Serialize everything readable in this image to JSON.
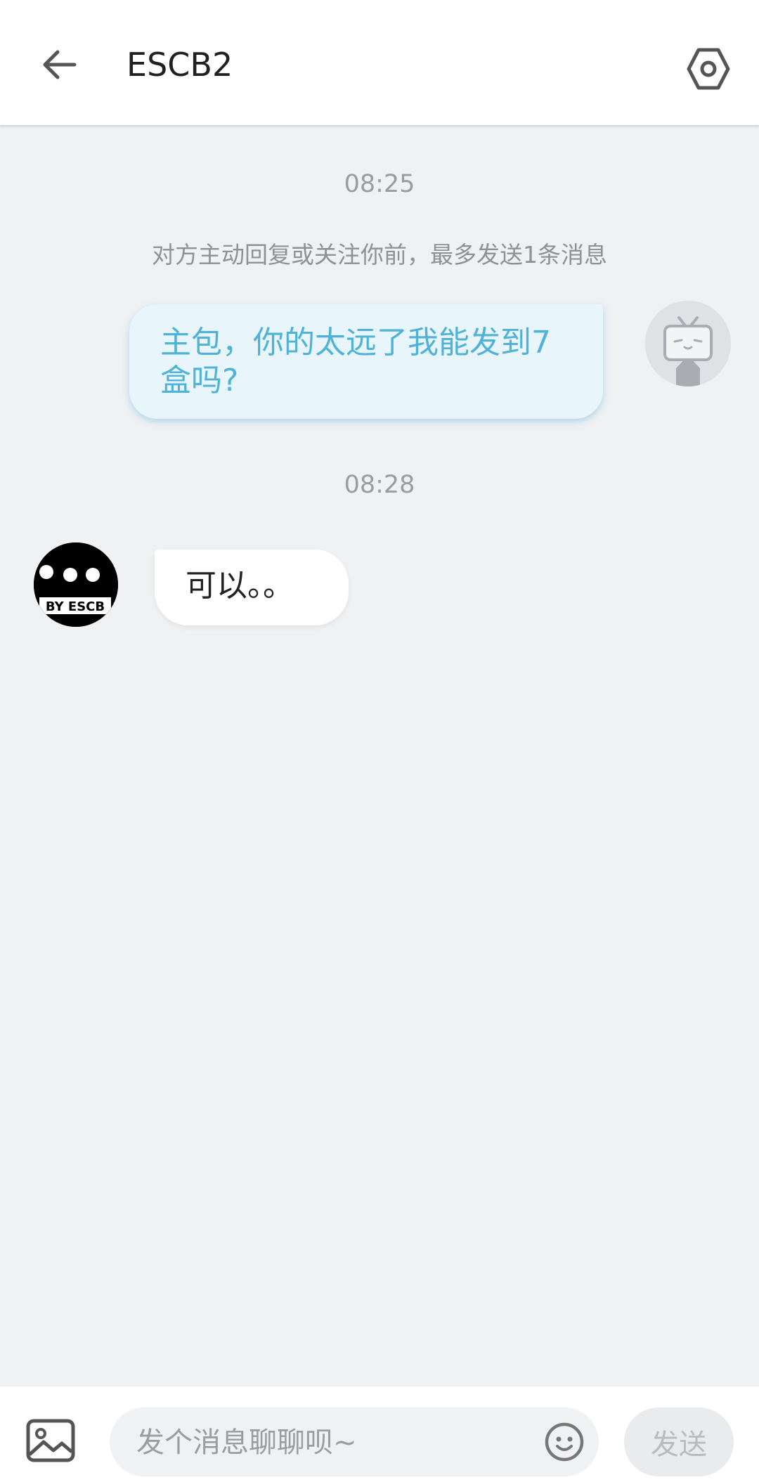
{
  "header": {
    "title": "ESCB2",
    "back_icon": "back-arrow-icon",
    "settings_icon": "hexagon-settings-icon"
  },
  "chat": {
    "messages_group_1": {
      "timestamp": "08:25",
      "notice": "对方主动回复或关注你前，最多发送1条消息",
      "outgoing_text": "主包，你的太远了我能发到7盒吗?"
    },
    "messages_group_2": {
      "timestamp": "08:28",
      "incoming_text": "可以。。",
      "incoming_avatar_text": "BY ESCB"
    }
  },
  "composer": {
    "placeholder": "发个消息聊聊呗~",
    "send_label": "发送",
    "image_icon": "image-icon",
    "emoji_icon": "emoji-icon"
  },
  "colors": {
    "background": "#f0f1f3",
    "outgoing_bubble": "#e8f6fc",
    "outgoing_text": "#4fb2d6",
    "incoming_bubble": "#ffffff"
  }
}
